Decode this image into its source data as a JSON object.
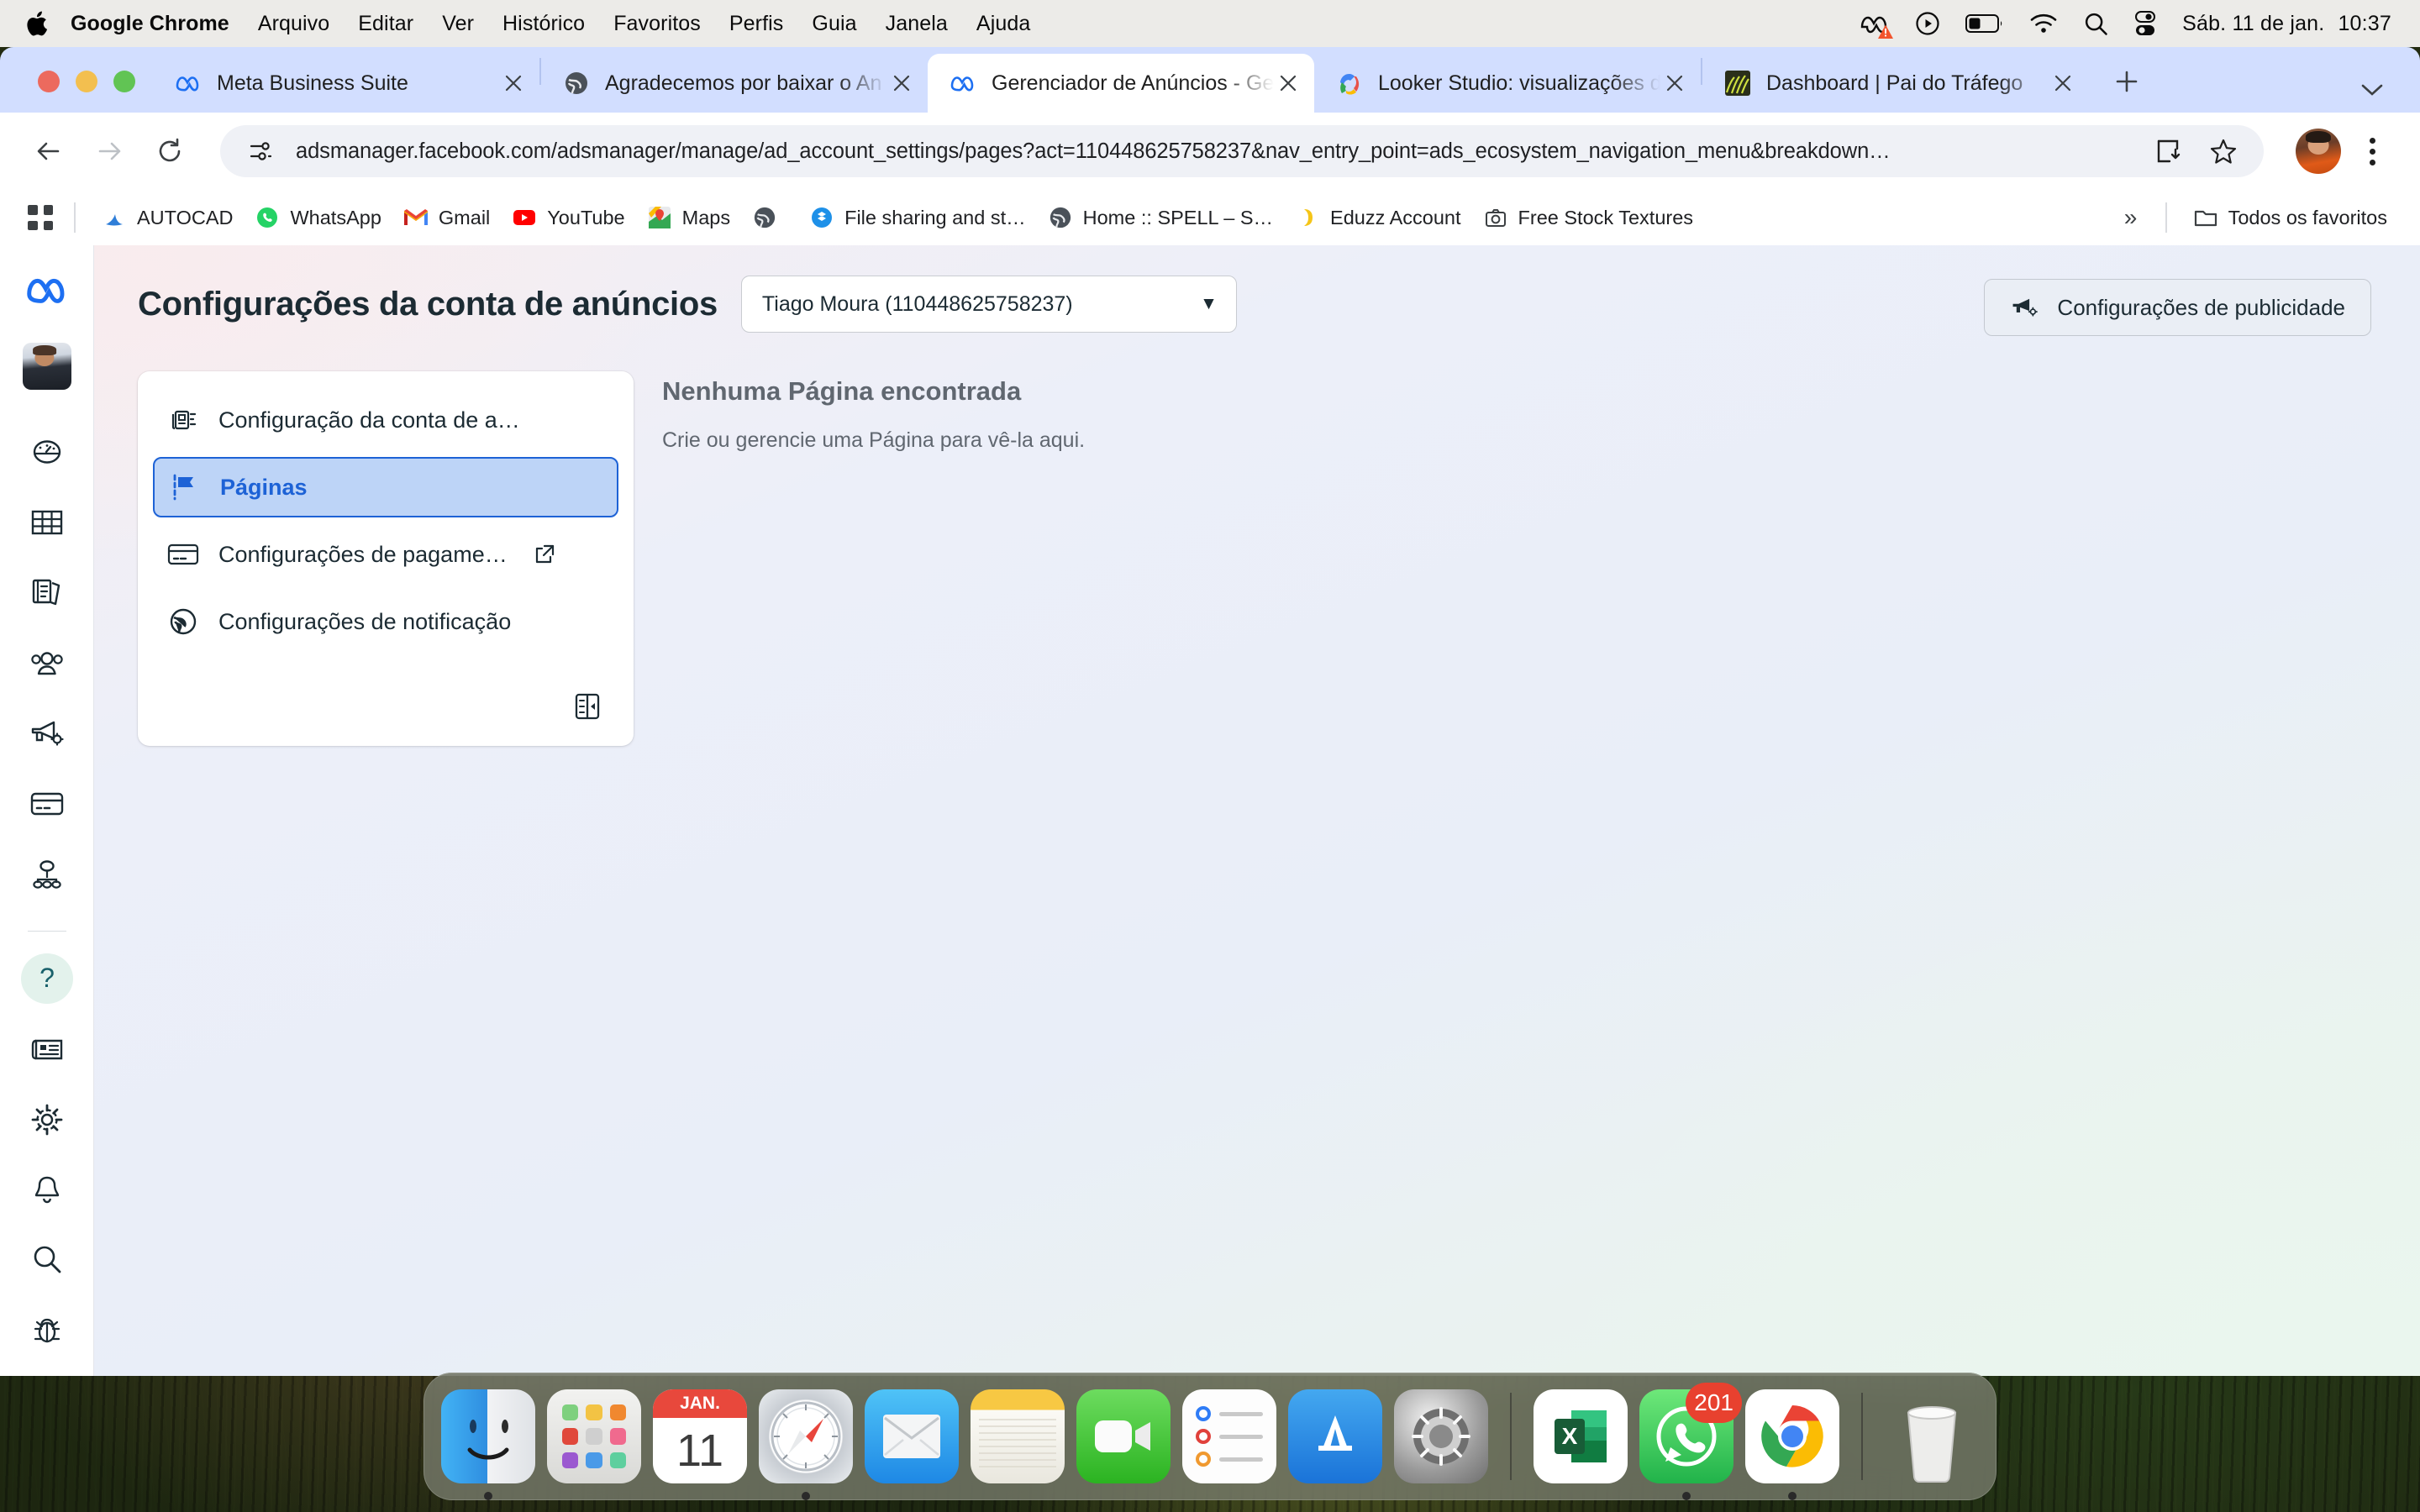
{
  "menubar": {
    "apple": "apple-logo",
    "items": [
      "Google Chrome",
      "Arquivo",
      "Editar",
      "Ver",
      "Histórico",
      "Favoritos",
      "Perfis",
      "Guia",
      "Janela",
      "Ajuda"
    ],
    "status_icons": [
      "meta-warning-icon",
      "play-circle-icon",
      "battery-icon",
      "wifi-icon",
      "spotlight-search-icon",
      "control-center-icon"
    ],
    "date": "Sáb. 11 de jan.",
    "time": "10:37"
  },
  "browser": {
    "tabs": [
      {
        "title": "Meta Business Suite",
        "favicon": "meta-icon",
        "active": false
      },
      {
        "title": "Agradecemos por baixar o An",
        "favicon": "globe-icon",
        "active": false
      },
      {
        "title": "Gerenciador de Anúncios - Ge",
        "favicon": "meta-icon",
        "active": true
      },
      {
        "title": "Looker Studio: visualizações d",
        "favicon": "looker-studio-icon",
        "active": false
      },
      {
        "title": "Dashboard | Pai do Tráfego",
        "favicon": "dashboard-icon",
        "active": false
      }
    ],
    "new_tab_label": "+",
    "tab_list_chevron": "chevron-down-icon",
    "toolbar": {
      "back": "back-arrow-icon",
      "forward": "forward-arrow-icon",
      "reload": "reload-icon",
      "site_info": "site-settings-icon",
      "url": "adsmanager.facebook.com/adsmanager/manage/ad_account_settings/pages?act=110448625758237&nav_entry_point=ads_ecosystem_navigation_menu&breakdown…",
      "install": "install-app-icon",
      "bookmark": "star-icon",
      "profile": "profile-avatar",
      "menu": "three-dot-menu-icon"
    },
    "bookmarks": {
      "apps_grid": "apps-grid-icon",
      "items": [
        {
          "label": "AUTOCAD",
          "icon": "autocad-icon"
        },
        {
          "label": "WhatsApp",
          "icon": "whatsapp-icon"
        },
        {
          "label": "Gmail",
          "icon": "gmail-icon"
        },
        {
          "label": "YouTube",
          "icon": "youtube-icon"
        },
        {
          "label": "Maps",
          "icon": "maps-icon"
        },
        {
          "label": "",
          "icon": "globe-icon"
        },
        {
          "label": "File sharing and st…",
          "icon": "dropbox-icon"
        },
        {
          "label": "Home :: SPELL – S…",
          "icon": "globe-icon"
        },
        {
          "label": "Eduzz Account",
          "icon": "eduzz-icon"
        },
        {
          "label": "Free Stock Textures",
          "icon": "camera-icon"
        }
      ],
      "overflow": "»",
      "all_bookmarks_label": "Todos os favoritos",
      "all_bookmarks_icon": "folder-icon"
    }
  },
  "rail": {
    "logo": "meta-logo",
    "avatar": "user-avatar",
    "icons": [
      "speedometer-icon",
      "table-icon",
      "pages-stack-icon",
      "audience-icon",
      "megaphone-settings-icon",
      "billing-card-icon",
      "share-network-icon"
    ],
    "bottom_icons": [
      "help-question-icon",
      "news-icon",
      "gear-icon",
      "bell-icon",
      "search-icon",
      "bug-icon"
    ]
  },
  "page": {
    "title": "Configurações da conta de anúncios",
    "account_selector": {
      "value": "Tiago Moura (110448625758237)",
      "caret": "chevron-down-icon"
    },
    "nav": [
      {
        "label": "Configuração da conta de a…",
        "icon": "account-setup-icon",
        "active": false,
        "external": false
      },
      {
        "label": "Páginas",
        "icon": "flag-icon",
        "active": true,
        "external": false
      },
      {
        "label": "Configurações de pagame…",
        "icon": "credit-card-icon",
        "active": false,
        "external": true
      },
      {
        "label": "Configurações de notificação",
        "icon": "globe-icon",
        "active": false,
        "external": false
      }
    ],
    "collapse_icon": "collapse-panel-icon",
    "empty_state": {
      "title": "Nenhuma Página encontrada",
      "subtitle": "Crie ou gerencie uma Página para vê-la aqui."
    },
    "ad_settings_button": {
      "label": "Configurações de publicidade",
      "icon": "megaphone-settings-icon"
    },
    "colors": {
      "accent": "#1d62d6",
      "active_bg": "#bdd4f7",
      "text": "#1c2b33",
      "muted_text": "#606770"
    }
  },
  "dock": {
    "apps": [
      {
        "name": "Finder",
        "icon": "finder-icon",
        "running": true
      },
      {
        "name": "Launchpad",
        "icon": "launchpad-icon",
        "running": false
      },
      {
        "name": "Calendário",
        "icon": "calendar-icon",
        "month": "JAN.",
        "day": "11",
        "running": false
      },
      {
        "name": "Safari",
        "icon": "safari-icon",
        "running": true
      },
      {
        "name": "Mail",
        "icon": "mail-icon",
        "running": false
      },
      {
        "name": "Notas",
        "icon": "notes-icon",
        "running": false
      },
      {
        "name": "FaceTime",
        "icon": "facetime-icon",
        "running": false
      },
      {
        "name": "Lembretes",
        "icon": "reminders-icon",
        "running": false
      },
      {
        "name": "App Store",
        "icon": "appstore-icon",
        "running": false
      },
      {
        "name": "Ajustes do Sistema",
        "icon": "system-preferences-icon",
        "running": false
      },
      {
        "name": "Microsoft Excel",
        "icon": "excel-icon",
        "running": false
      },
      {
        "name": "WhatsApp",
        "icon": "whatsapp-icon",
        "badge": "201",
        "running": true
      },
      {
        "name": "Google Chrome",
        "icon": "chrome-icon",
        "running": true
      },
      {
        "name": "Lixo",
        "icon": "trash-icon",
        "running": false
      }
    ]
  }
}
